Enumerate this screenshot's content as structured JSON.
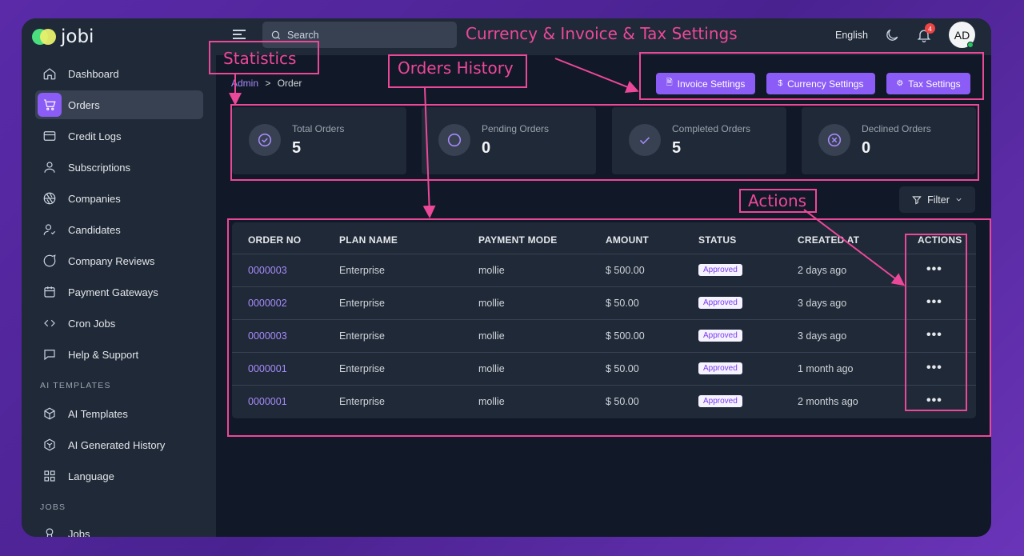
{
  "brand": {
    "name": "jobi"
  },
  "sidebar": {
    "items": [
      {
        "label": "Dashboard"
      },
      {
        "label": "Orders"
      },
      {
        "label": "Credit Logs"
      },
      {
        "label": "Subscriptions"
      },
      {
        "label": "Companies"
      },
      {
        "label": "Candidates"
      },
      {
        "label": "Company Reviews"
      },
      {
        "label": "Payment Gateways"
      },
      {
        "label": "Cron Jobs"
      },
      {
        "label": "Help & Support"
      }
    ],
    "section_ai": "AI TEMPLATES",
    "ai_items": [
      {
        "label": "AI Templates"
      },
      {
        "label": "AI Generated History"
      },
      {
        "label": "Language"
      }
    ],
    "section_jobs": "JOBS",
    "jobs_items": [
      {
        "label": "Jobs"
      }
    ]
  },
  "topbar": {
    "search_placeholder": "Search",
    "language": "English",
    "notification_count": "4",
    "avatar_initials": "AD"
  },
  "breadcrumb": {
    "root": "Admin",
    "separator": ">",
    "current": "Order"
  },
  "actions": {
    "invoice": "Invoice Settings",
    "currency": "Currency Settings",
    "tax": "Tax Settings"
  },
  "stats": [
    {
      "label": "Total Orders",
      "value": "5"
    },
    {
      "label": "Pending Orders",
      "value": "0"
    },
    {
      "label": "Completed Orders",
      "value": "5"
    },
    {
      "label": "Declined Orders",
      "value": "0"
    }
  ],
  "filter_label": "Filter",
  "table": {
    "headers": [
      "ORDER NO",
      "PLAN NAME",
      "PAYMENT MODE",
      "AMOUNT",
      "STATUS",
      "CREATED AT",
      "ACTIONS"
    ],
    "rows": [
      {
        "order": "0000003",
        "plan": "Enterprise",
        "mode": "mollie",
        "amount": "$ 500.00",
        "status": "Approved",
        "created": "2 days ago"
      },
      {
        "order": "0000002",
        "plan": "Enterprise",
        "mode": "mollie",
        "amount": "$ 50.00",
        "status": "Approved",
        "created": "3 days ago"
      },
      {
        "order": "0000003",
        "plan": "Enterprise",
        "mode": "mollie",
        "amount": "$ 500.00",
        "status": "Approved",
        "created": "3 days ago"
      },
      {
        "order": "0000001",
        "plan": "Enterprise",
        "mode": "mollie",
        "amount": "$ 50.00",
        "status": "Approved",
        "created": "1 month ago"
      },
      {
        "order": "0000001",
        "plan": "Enterprise",
        "mode": "mollie",
        "amount": "$ 50.00",
        "status": "Approved",
        "created": "2 months ago"
      }
    ]
  },
  "annotations": {
    "title": "Currency & Invoice & Tax Settings",
    "statistics": "Statistics",
    "orders_history": "Orders History",
    "actions": "Actions"
  },
  "colors": {
    "accent": "#8b5cf6",
    "annotation": "#ec4899",
    "sidebar": "#1f2937",
    "main": "#111827"
  }
}
